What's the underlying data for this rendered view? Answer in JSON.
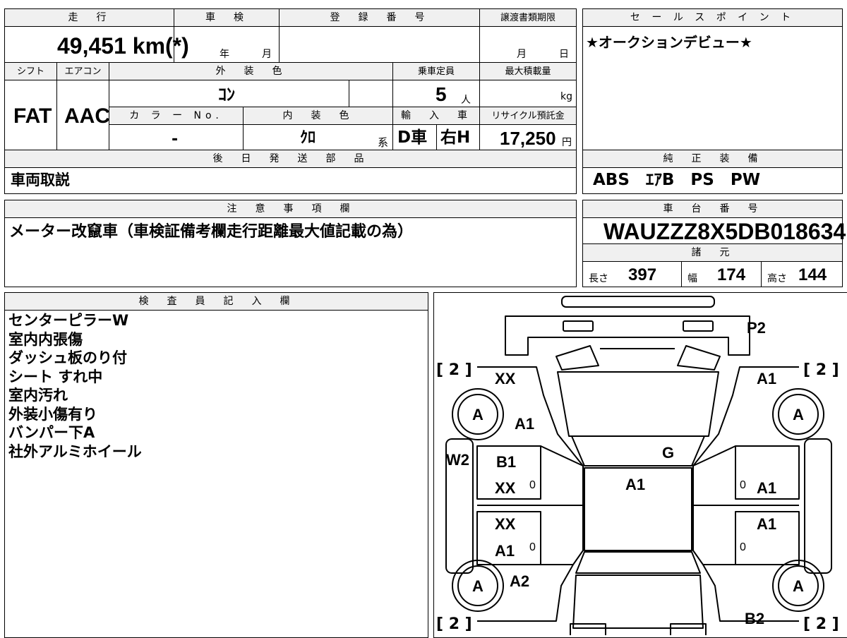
{
  "main_table": {
    "mileage_header": "走　行",
    "mileage_value": "49,451 km(*)",
    "inspection_header": "車　検",
    "inspection_year": "年",
    "inspection_month": "月",
    "reg_number_header": "登　録　番　号",
    "transfer_header": "譲渡書類期限",
    "transfer_month": "月",
    "transfer_day": "日",
    "shift_header": "シフト",
    "shift_value": "FAT",
    "aircon_header": "エアコン",
    "aircon_value": "AAC",
    "ext_color_header": "外　装　色",
    "ext_color_value": "ｺﾝ",
    "capacity_header": "乗車定員",
    "capacity_value": "5",
    "capacity_unit": "人",
    "max_load_header": "最大積載量",
    "max_load_unit": "kg",
    "color_no_header": "カ ラ ー No.",
    "color_no_value": "-",
    "int_color_header": "内　装　色",
    "int_color_value": "ｸﾛ",
    "int_color_suffix": "系",
    "import_header": "輸　入　車",
    "import_value": "D車",
    "handle_value": "右H",
    "recycle_header": "リサイクル預託金",
    "recycle_value": "17,250",
    "recycle_unit": "円",
    "later_parts_header": "後　日　発　送　部　品",
    "later_parts_value": "車両取説"
  },
  "sales_point": {
    "header": "セ ー ル ス ポ イ ン ト",
    "text": "★オークションデビュー★"
  },
  "genuine_equipment": {
    "header": "純　正　装　備",
    "value": "ABS　ｴｱB　PS　PW"
  },
  "notes": {
    "header": "注　意　事　項　欄",
    "text": "メーター改竄車（車検証備考欄走行距離最大値記載の為）"
  },
  "chassis": {
    "header": "車　台　番　号",
    "value": "WAUZZZ8X5DB018634"
  },
  "specs": {
    "header": "諸　元",
    "length_label": "長さ",
    "length_value": "397",
    "width_label": "幅",
    "width_value": "174",
    "height_label": "高さ",
    "height_value": "144"
  },
  "inspector": {
    "header": "検　査　員　記　入　欄",
    "lines": [
      "センターピラーW",
      "室内内張傷",
      "ダッシュ板のり付",
      "シート すれ中",
      "室内汚れ",
      "外装小傷有り",
      "バンパー下A",
      "社外アルミホイール"
    ]
  },
  "diagram": {
    "marks": {
      "p2": "P2",
      "xx_fl": "XX",
      "a1_fr_fender": "A1",
      "a1_fl": "A1",
      "g_windshield": "G",
      "w2_pillar": "W2",
      "b1_fl_door": "B1",
      "xx_fl_door": "XX",
      "a1_roof": "A1",
      "a1_fr_door": "A1",
      "xx_rl_door": "XX",
      "a1_rl_door": "A1",
      "a1_rr_door": "A1",
      "a2_rl": "A2",
      "b2_rr": "B2"
    },
    "tire_label": "A",
    "tire_bracket": "[ 2 ]",
    "zero": "0"
  },
  "colors": {
    "header_bg": "#f0f0f0",
    "border": "#000000"
  }
}
